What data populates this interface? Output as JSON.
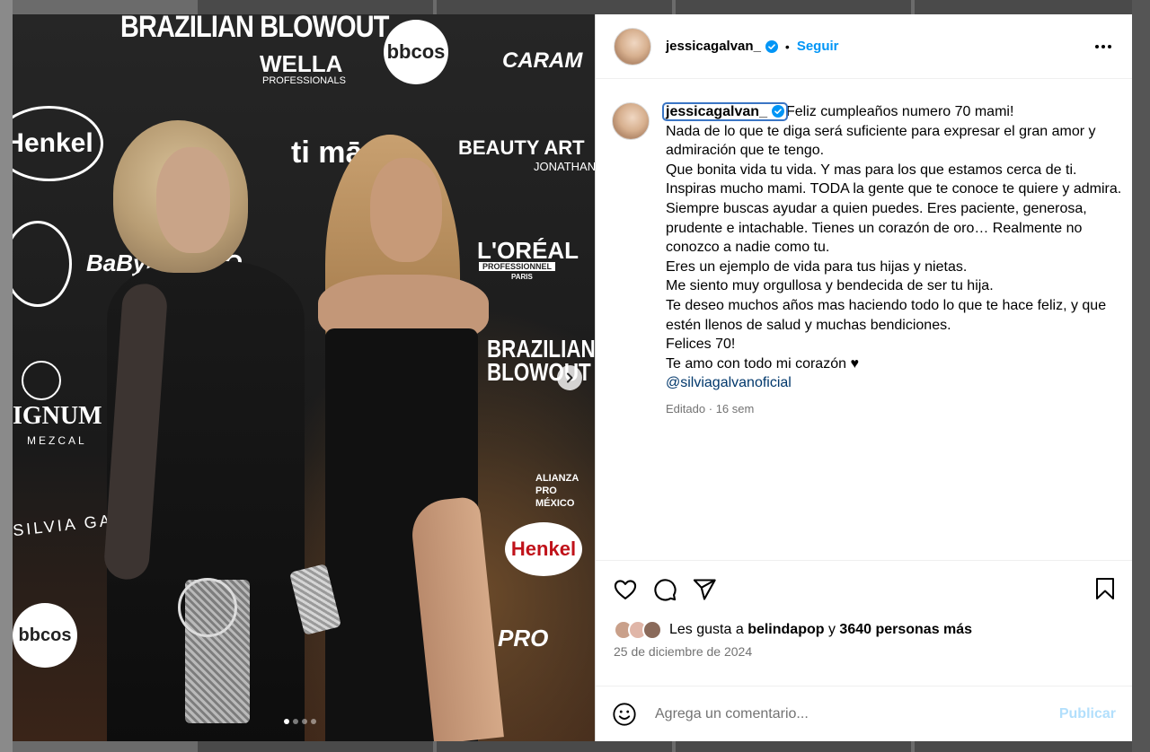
{
  "post": {
    "username": "jessicagalvan_",
    "follow_label": "Seguir",
    "separator": "•",
    "caption_lines": "Feliz cumpleaños numero 70 mami!\nNada de lo que te diga será suficiente para expresar el gran amor y admiración que te tengo.\nQue bonita vida tu vida. Y mas para los que estamos cerca de ti. Inspiras mucho mami. TODA la gente que te conoce te quiere y admira. Siempre buscas ayudar a quien puedes. Eres paciente, generosa, prudente e intachable. Tienes un corazón de oro… Realmente no conozco a nadie como tu.\nEres un ejemplo de vida para tus hijas y nietas.\nMe siento muy orgullosa y bendecida de ser tu hija.\nTe deseo muchos años mas haciendo todo lo que te hace feliz, y que estén llenos de salud y muchas bendiciones.\nFelices 70!\nTe amo con todo mi corazón ♥",
    "mention": "@silviagalvanoficial",
    "edited": "Editado",
    "dot": "·",
    "age": "16 sem",
    "likes_prefix": "Les gusta a",
    "likes_user": "belindapop",
    "likes_and": "y",
    "likes_others": "3640 personas más",
    "date": "25 de diciembre de 2024",
    "comment_placeholder": "Agrega un comentario...",
    "post_label": "Publicar",
    "carousel": {
      "total": 4,
      "current": 1
    }
  },
  "photo_text": {
    "brazilian_blowout": "BRAZILIAN BLOWOUT",
    "wella": "WELLA",
    "wella_sub": "PROFESSIONALS",
    "bbcos": "bbcos",
    "caram": "CARAM",
    "henkel": "Henkel",
    "ti": "ti mā",
    "beauty_art": "BEAUTY ART",
    "jonathan": "JONATHAN",
    "loreal": "L'ORÉAL",
    "loreal_sub": "PROFESSIONNEL",
    "paris": "PARIS",
    "babyliss": "BaByliss PRO",
    "ignum": "IGNUM",
    "mezcal": "MEZCAL",
    "silvia": "SILVIA GALV",
    "alianza": "ALIANZA PRO MÉXICO",
    "pro": "PRO"
  },
  "colors": {
    "accent": "#0095f6",
    "mention": "#00376b",
    "secondary_text": "#737373",
    "post_disabled": "#b2dffc"
  },
  "icons": [
    "verified-badge-icon",
    "more-options-icon",
    "chevron-right-icon",
    "heart-icon",
    "comment-icon",
    "share-icon",
    "bookmark-icon",
    "emoji-icon"
  ]
}
